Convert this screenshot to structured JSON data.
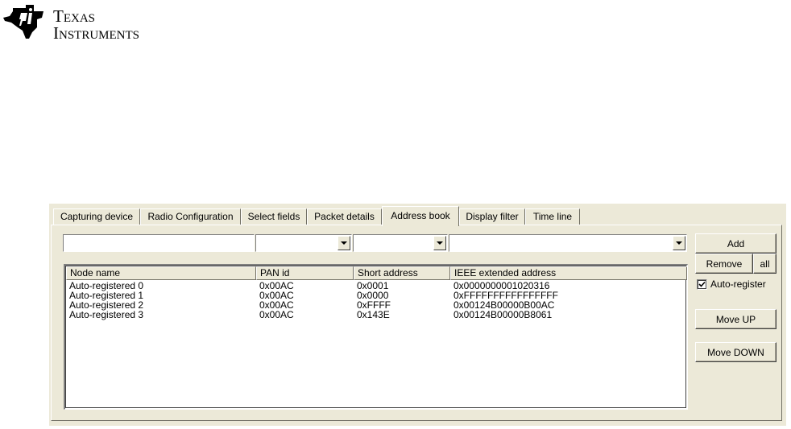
{
  "logo": {
    "line1": "Texas",
    "line2": "Instruments"
  },
  "tabs": [
    {
      "label": "Capturing device",
      "active": false
    },
    {
      "label": "Radio Configuration",
      "active": false
    },
    {
      "label": "Select fields",
      "active": false
    },
    {
      "label": "Packet details",
      "active": false
    },
    {
      "label": "Address book",
      "active": true
    },
    {
      "label": "Display filter",
      "active": false
    },
    {
      "label": "Time line",
      "active": false
    }
  ],
  "inputs": {
    "node_name": {
      "value": ""
    },
    "pan_id": {
      "value": ""
    },
    "short_address": {
      "value": ""
    },
    "ieee_address": {
      "value": ""
    }
  },
  "table": {
    "columns": [
      "Node name",
      "PAN id",
      "Short address",
      "IEEE extended address"
    ],
    "rows": [
      [
        "Auto-registered 0",
        "0x00AC",
        "0x0001",
        "0x0000000001020316"
      ],
      [
        "Auto-registered 1",
        "0x00AC",
        "0x0000",
        "0xFFFFFFFFFFFFFFFF"
      ],
      [
        "Auto-registered 2",
        "0x00AC",
        "0xFFFF",
        "0x00124B00000B00AC"
      ],
      [
        "Auto-registered 3",
        "0x00AC",
        "0x143E",
        "0x00124B00000B8061"
      ]
    ]
  },
  "buttons": {
    "add": "Add",
    "remove": "Remove",
    "all": "all",
    "move_up": "Move UP",
    "move_down": "Move DOWN"
  },
  "auto_register": {
    "label": "Auto-register",
    "checked": true
  },
  "colors": {
    "face": "#ece9d8",
    "shadow": "#716f64",
    "highlight": "#ffffff"
  }
}
